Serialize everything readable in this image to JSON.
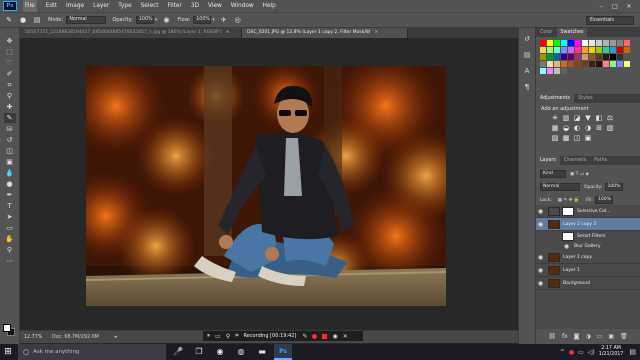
{
  "menubar": {
    "logo": "Ps",
    "items": [
      "File",
      "Edit",
      "Image",
      "Layer",
      "Type",
      "Select",
      "Filter",
      "3D",
      "View",
      "Window",
      "Help"
    ],
    "window_controls": [
      "–",
      "□",
      "✕"
    ]
  },
  "options": {
    "mode_label": "Mode:",
    "mode_value": "Normal",
    "opacity_label": "Opacity:",
    "opacity_value": "100%",
    "flow_label": "Flow:",
    "flow_value": "100%",
    "workspace": "Essentials"
  },
  "tabs": [
    {
      "label": "56567372_52189838194417_6854644685478632857_n.jpg @ 180% (Layer 1, RGB/8*)",
      "active": false
    },
    {
      "label": "DSC_0201.JPG @ 12.8% (Layer 1 copy 2, Filter Mask/8)",
      "active": true
    }
  ],
  "status": {
    "zoom": "12.77%",
    "doc": "Doc: 68.7M/292.0M"
  },
  "recorder": {
    "text": "Recording [00:19:42]"
  },
  "color_panel": {
    "tabs": [
      "Color",
      "Swatches"
    ],
    "active": "Swatches",
    "swatches": [
      "#ff0000",
      "#ffff00",
      "#00ff00",
      "#00ffff",
      "#0000ff",
      "#ff00ff",
      "#ffffff",
      "#e6e6e6",
      "#cccccc",
      "#b3b3b3",
      "#999999",
      "#808080",
      "#ff6666",
      "#ffcc66",
      "#99ff66",
      "#66ffcc",
      "#6699ff",
      "#cc66ff",
      "#ff3399",
      "#ff9933",
      "#ffcc00",
      "#99cc00",
      "#33cc99",
      "#3399cc",
      "#cc0000",
      "#cc6600",
      "#999900",
      "#009933",
      "#006699",
      "#330099",
      "#660066",
      "#993366",
      "#c8a070",
      "#8b5a2b",
      "#5a3a1a",
      "#2a1a0a",
      "#000000",
      "#333333",
      "#555555",
      "#777777",
      "#f5deb3",
      "#deb887",
      "#d2691e",
      "#a0522d",
      "#8b4513",
      "#654321",
      "#402010",
      "#201008",
      "#ff8080",
      "#80ff80",
      "#8080ff",
      "#ffff80",
      "#80ffff",
      "#ff80ff",
      "#c0c0c0",
      "#606060"
    ]
  },
  "adjustments": {
    "tabs": [
      "Adjustments",
      "Styles"
    ],
    "active": "Adjustments",
    "title": "Add an adjustment",
    "icons": [
      "☀",
      "▥",
      "◪",
      "▼",
      "◧",
      "⚖",
      "▦",
      "◒",
      "◐",
      "◑",
      "⊞",
      "▧",
      "▨",
      "▩",
      "◫",
      "▣"
    ]
  },
  "layers_panel": {
    "tabs": [
      "Layers",
      "Channels",
      "Paths"
    ],
    "active": "Layers",
    "kind": "Kind",
    "blend": "Normal",
    "opacity_label": "Opacity:",
    "opacity": "100%",
    "lock_label": "Lock:",
    "fill_label": "Fill:",
    "fill": "100%",
    "layers": [
      {
        "name": "Selective Col...",
        "visible": true,
        "selected": false,
        "thumb": "#ffffff"
      },
      {
        "name": "Layer 1 copy 2",
        "visible": true,
        "selected": true,
        "thumb": "#2a1a0a"
      },
      {
        "name": "Smart Filters",
        "visible": true,
        "selected": false,
        "sub": true
      },
      {
        "name": "Blur Gallery",
        "visible": true,
        "selected": false,
        "sub": true
      },
      {
        "name": "Layer 1 copy",
        "visible": true,
        "selected": false,
        "thumb": "#3a1a0a"
      },
      {
        "name": "Layer 1",
        "visible": true,
        "selected": false,
        "thumb": "#3a1a0a"
      },
      {
        "name": "Background",
        "visible": true,
        "selected": false,
        "thumb": "#3a1a0a"
      }
    ]
  },
  "taskbar": {
    "search_placeholder": "Ask me anything",
    "ps_label": "Ps",
    "time": "2:17 AM",
    "date": "1/21/2017"
  }
}
